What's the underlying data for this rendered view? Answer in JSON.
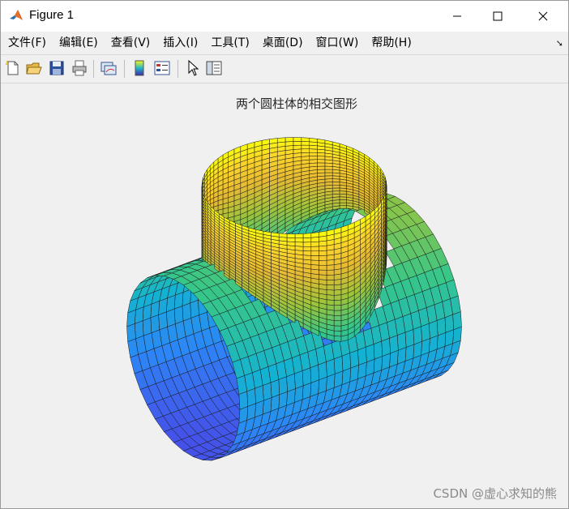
{
  "window": {
    "title": "Figure 1"
  },
  "menu": {
    "items": [
      "文件(F)",
      "编辑(E)",
      "查看(V)",
      "插入(I)",
      "工具(T)",
      "桌面(D)",
      "窗口(W)",
      "帮助(H)"
    ]
  },
  "toolbar": {
    "buttons": [
      "new-figure-icon",
      "open-file-icon",
      "save-icon",
      "print-icon",
      "link-plot-icon",
      "insert-colorbar-icon",
      "insert-legend-icon",
      "edit-plot-cursor-icon",
      "property-inspector-icon"
    ]
  },
  "plot": {
    "title": "两个圆柱体的相交图形",
    "colormap": "parula"
  },
  "watermark": "CSDN @虚心求知的熊"
}
